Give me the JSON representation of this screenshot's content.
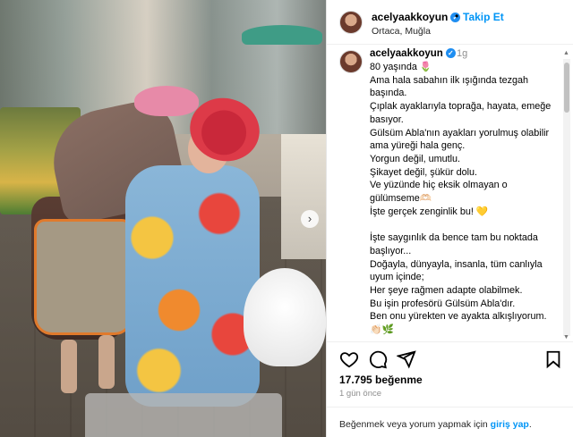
{
  "post": {
    "username": "acelyaakkoyun",
    "follow_label": "Takip Et",
    "location": "Ortaca, Muğla",
    "separator": "•"
  },
  "comment": {
    "username": "acelyaakkoyun",
    "time": "1g",
    "caption": "80 yaşında 🌷\nAma hala sabahın ilk ışığında tezgah başında.\nÇıplak ayaklarıyla toprağa, hayata, emeğe basıyor.\nGülsüm Abla'nın ayakları yorulmuş olabilir ama yüreği hala genç.\nYorgun değil, umutlu.\nŞikayet değil, şükür dolu.\nVe yüzünde hiç eksik olmayan o gülümseme🫶🏻\nİşte gerçek zenginlik bu! 💛\n\nİşte saygınlık da bence tam bu noktada başlıyor...\nDoğayla, dünyayla, insanla, tüm canlıyla uyum içinde;\nHer şeye rağmen adapte olabilmek.\nBu işin profesörü Gülsüm Abla'dır.\nBen onu yürekten ve ayakta alkışlıyorum. 👏🏻🌿"
  },
  "stats": {
    "likes": "17.795 beğenme",
    "ago": "1 gün önce"
  },
  "login": {
    "prefix": "Beğenmek veya yorum yapmak için ",
    "link": "giriş yap",
    "suffix": "."
  },
  "icons": {
    "like": "heart-icon",
    "comment": "comment-icon",
    "share": "share-icon",
    "save": "bookmark-icon",
    "verified": "verified-badge-icon",
    "next": "chevron-right-icon"
  },
  "colors": {
    "accent": "#0095f6",
    "verified": "#1f8ef1",
    "muted": "#8e8e8e"
  }
}
